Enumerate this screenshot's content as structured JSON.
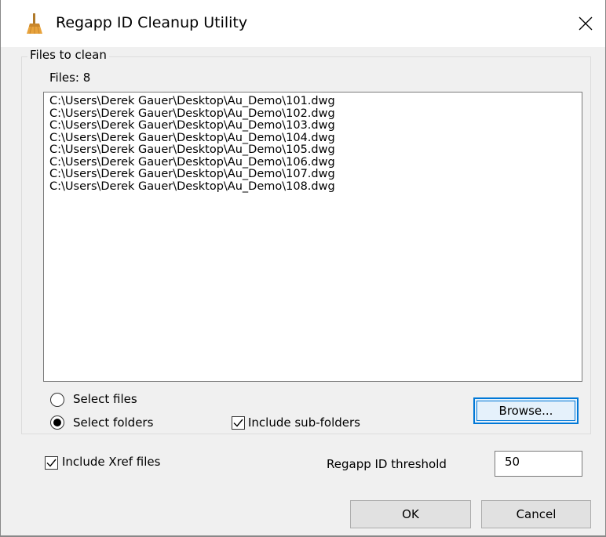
{
  "window": {
    "title": "Regapp ID Cleanup Utility",
    "icon": "broom-icon",
    "close_icon": "close-icon"
  },
  "files_group": {
    "legend": "Files to clean",
    "count_label": "Files: 8",
    "files": [
      "C:\\Users\\Derek Gauer\\Desktop\\Au_Demo\\101.dwg",
      "C:\\Users\\Derek Gauer\\Desktop\\Au_Demo\\102.dwg",
      "C:\\Users\\Derek Gauer\\Desktop\\Au_Demo\\103.dwg",
      "C:\\Users\\Derek Gauer\\Desktop\\Au_Demo\\104.dwg",
      "C:\\Users\\Derek Gauer\\Desktop\\Au_Demo\\105.dwg",
      "C:\\Users\\Derek Gauer\\Desktop\\Au_Demo\\106.dwg",
      "C:\\Users\\Derek Gauer\\Desktop\\Au_Demo\\107.dwg",
      "C:\\Users\\Derek Gauer\\Desktop\\Au_Demo\\108.dwg"
    ],
    "select_files_label": "Select files",
    "select_files_checked": false,
    "select_folders_label": "Select folders",
    "select_folders_checked": true,
    "include_subfolders_label": "Include sub-folders",
    "include_subfolders_checked": true,
    "browse_label": "Browse..."
  },
  "options": {
    "include_xref_label": "Include Xref files",
    "include_xref_checked": true,
    "threshold_label": "Regapp ID threshold",
    "threshold_value": "50"
  },
  "buttons": {
    "ok_label": "OK",
    "cancel_label": "Cancel"
  },
  "colors": {
    "accent": "#0078d7",
    "dialog_bg": "#f0f0f0",
    "button_bg": "#e1e1e1"
  }
}
